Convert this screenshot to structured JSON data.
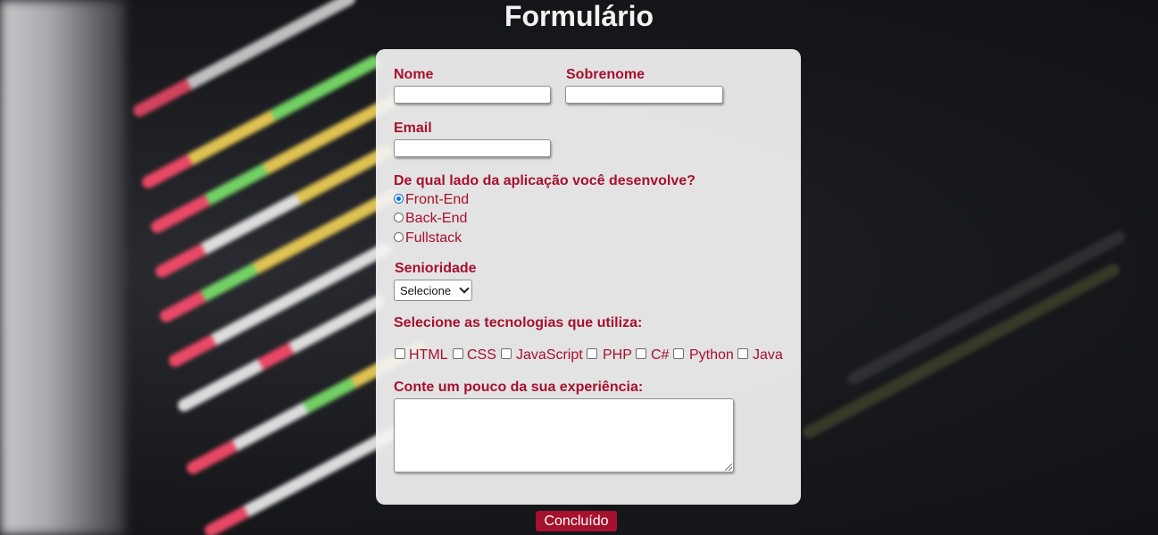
{
  "page": {
    "title": "Formulário"
  },
  "form": {
    "name_label": "Nome",
    "surname_label": "Sobrenome",
    "email_label": "Email",
    "side_question": "De qual lado da aplicação você desenvolve?",
    "side_options": [
      {
        "label": "Front-End",
        "checked": true
      },
      {
        "label": "Back-End",
        "checked": false
      },
      {
        "label": "Fullstack",
        "checked": false
      }
    ],
    "seniority_label": "Senioridade",
    "seniority_selected": "Selecione",
    "tech_question": "Selecione as tecnologias que utiliza:",
    "technologies": [
      "HTML",
      "CSS",
      "JavaScript",
      "PHP",
      "C#",
      "Python",
      "Java"
    ],
    "experience_label": "Conte um pouco da sua experiência:",
    "submit_label": "Concluído"
  },
  "colors": {
    "accent": "#a6112d",
    "card": "#f2f2f2",
    "radio_selected": "#0b6fd6"
  }
}
